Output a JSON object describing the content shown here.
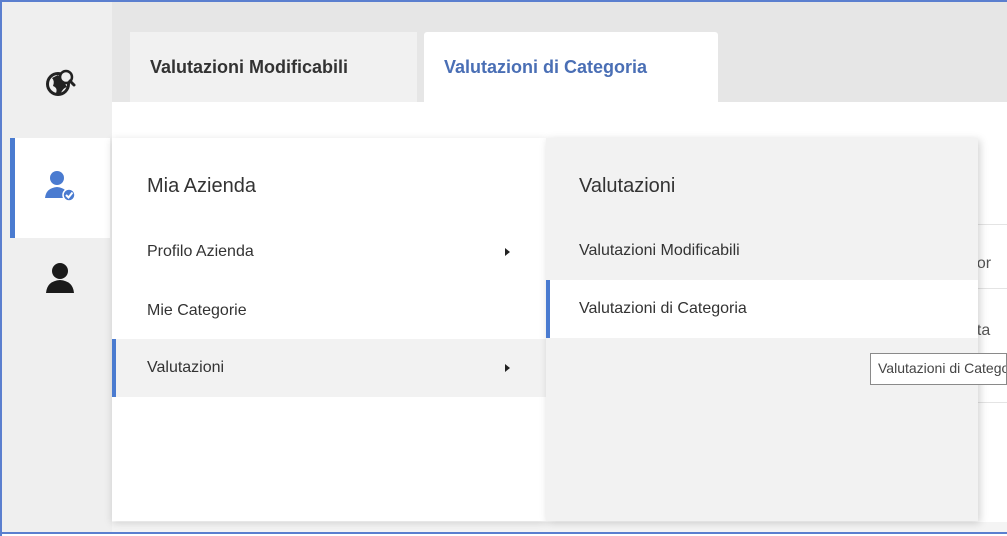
{
  "tabs": [
    {
      "label": "Valutazioni Modificabili",
      "active": false
    },
    {
      "label": "Valutazioni di Categoria",
      "active": true
    }
  ],
  "rail": {
    "items": [
      {
        "icon": "globe-search-icon",
        "active": false
      },
      {
        "icon": "user-check-icon",
        "active": true
      },
      {
        "icon": "user-icon",
        "active": false
      }
    ]
  },
  "menu": {
    "title": "Mia Azienda",
    "items": [
      {
        "label": "Profilo Azienda",
        "has_submenu": true
      },
      {
        "label": "Mie Categorie",
        "has_submenu": false
      },
      {
        "label": "Valutazioni",
        "has_submenu": true,
        "selected": true
      }
    ]
  },
  "submenu": {
    "title": "Valutazioni",
    "items": [
      {
        "label": "Valutazioni Modificabili"
      },
      {
        "label": "Valutazioni di Categoria",
        "hover": true
      }
    ]
  },
  "background": {
    "col_fragment": "nor",
    "row_fragment": "uta"
  },
  "tooltip": {
    "text": "Valutazioni di Categoria"
  },
  "colors": {
    "accent": "#4a7bd0",
    "tab_active_text": "#4a6fb5"
  }
}
